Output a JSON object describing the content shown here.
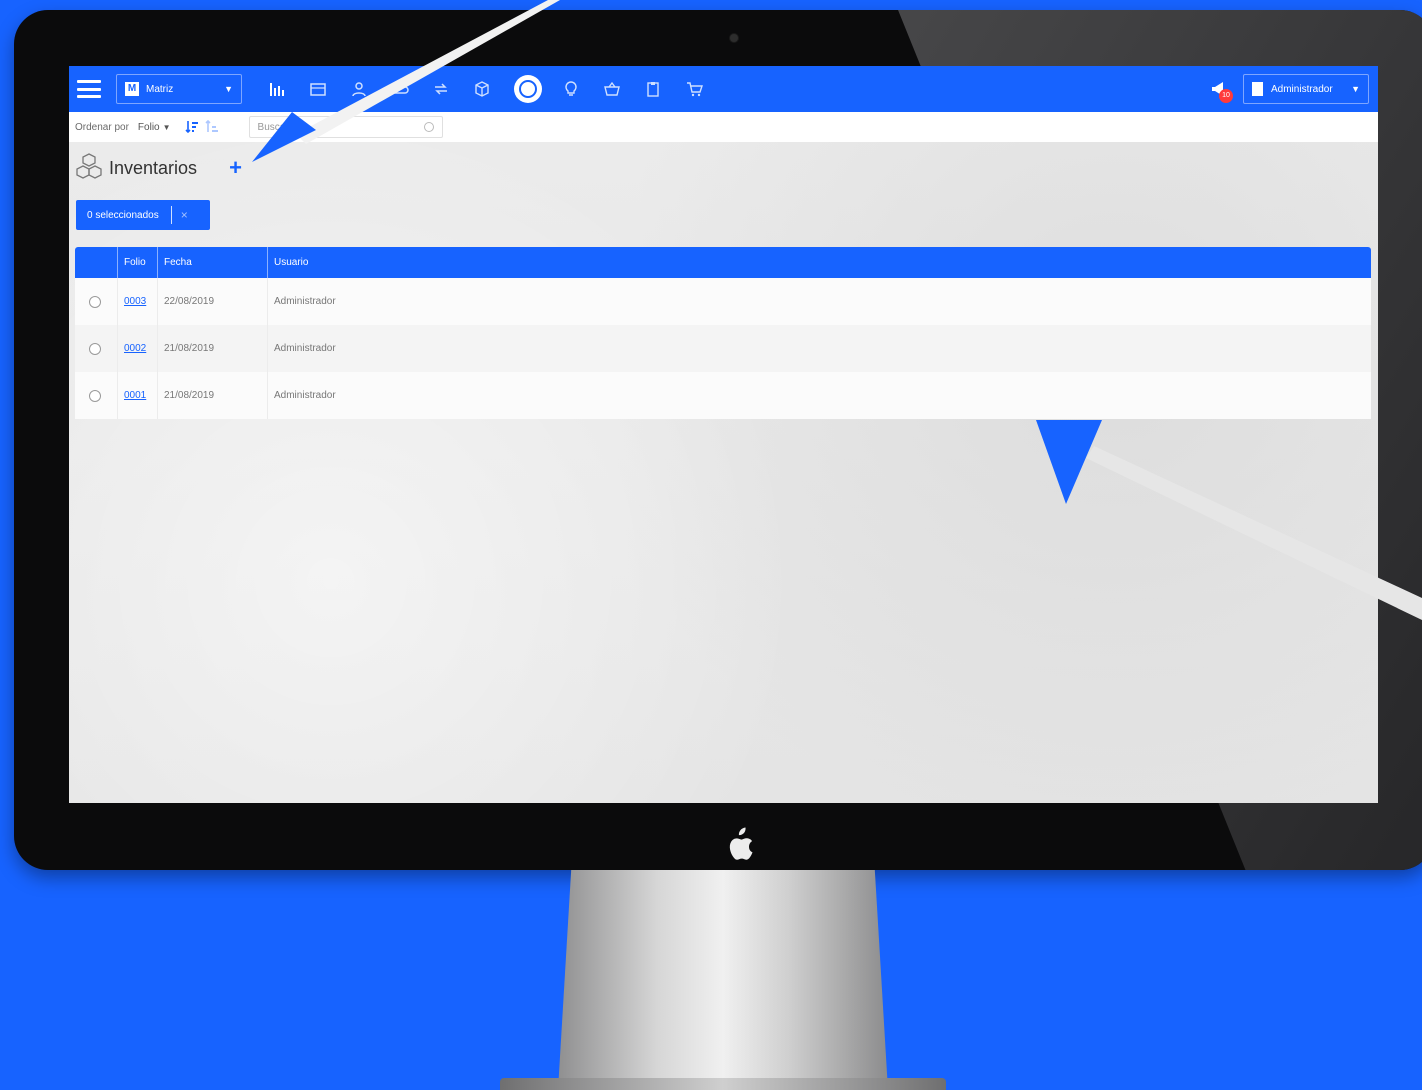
{
  "colors": {
    "brand_blue": "#1763ff",
    "screen_bg": "#e9e9ea",
    "badge_red": "#ff3a3a"
  },
  "topbar": {
    "branch_label": "Matriz",
    "branch_letter": "M",
    "notification_count": "10",
    "user_label": "Administrador",
    "icons": [
      "bar-chart-icon",
      "calendar-icon",
      "user-icon",
      "cloud-icon",
      "transfer-icon",
      "box-icon",
      "profile-circle-icon",
      "lightbulb-icon",
      "basket-icon",
      "clipboard-icon",
      "cart-icon"
    ]
  },
  "sortbar": {
    "order_label": "Ordenar por",
    "order_value": "Folio",
    "search_placeholder": "Buscar"
  },
  "page": {
    "title": "Inventarios",
    "add_label": "+",
    "selected_label": "0 seleccionados",
    "clear_label": "×"
  },
  "table": {
    "headers": [
      "Folio",
      "Fecha",
      "Usuario"
    ],
    "rows": [
      {
        "folio": "0003",
        "fecha": "22/08/2019",
        "usuario": "Administrador"
      },
      {
        "folio": "0002",
        "fecha": "21/08/2019",
        "usuario": "Administrador"
      },
      {
        "folio": "0001",
        "fecha": "21/08/2019",
        "usuario": "Administrador"
      }
    ]
  }
}
